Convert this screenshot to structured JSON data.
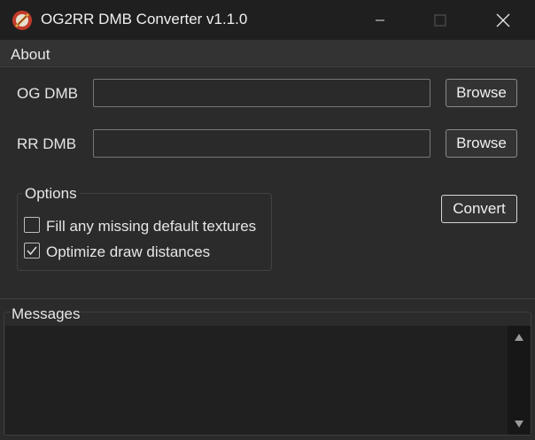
{
  "window": {
    "title": "OG2RR DMB Converter v1.1.0"
  },
  "menu": {
    "items": [
      {
        "label": "About"
      }
    ]
  },
  "form": {
    "og_dmb": {
      "label": "OG DMB",
      "value": "",
      "browse_label": "Browse"
    },
    "rr_dmb": {
      "label": "RR DMB",
      "value": "",
      "browse_label": "Browse"
    },
    "convert_label": "Convert"
  },
  "options": {
    "legend": "Options",
    "fill_textures": {
      "label": "Fill any missing default textures",
      "checked": false
    },
    "optimize_draw": {
      "label": "Optimize draw distances",
      "checked": true
    }
  },
  "messages": {
    "legend": "Messages",
    "text": ""
  },
  "colors": {
    "titlebar_bg": "#1f1f1f",
    "window_bg": "#2b2b2b",
    "icon_ring": "#c23b2a",
    "icon_center": "#d9a441"
  },
  "icons": {
    "app": "app-logo-icon",
    "minimize": "minimize-icon",
    "maximize": "maximize-icon",
    "close": "close-icon",
    "check": "checkmark-icon",
    "scroll_up": "triangle-up-icon",
    "scroll_down": "triangle-down-icon"
  }
}
